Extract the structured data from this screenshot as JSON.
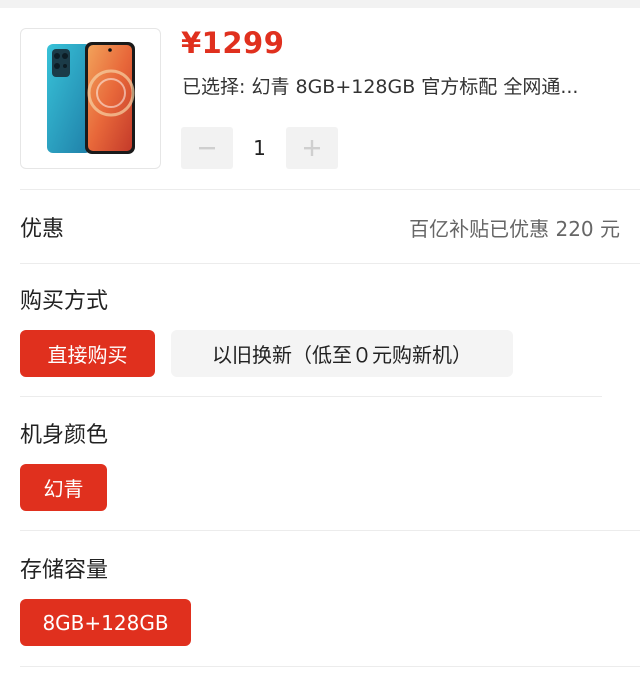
{
  "product": {
    "price": "¥1299",
    "selected_text": "已选择: 幻青 8GB+128GB 官方标配 全网通...",
    "quantity": "1",
    "image_name": "phone-image"
  },
  "promo": {
    "label": "优惠",
    "value": "百亿补贴已优惠 220 元"
  },
  "purchase": {
    "label": "购买方式",
    "options": [
      "直接购买",
      "以旧换新（低至０元购新机）"
    ],
    "selected_index": 0
  },
  "color": {
    "label": "机身颜色",
    "options": [
      "幻青"
    ],
    "selected_index": 0
  },
  "storage": {
    "label": "存储容量",
    "options": [
      "8GB+128GB"
    ],
    "selected_index": 0
  },
  "theme": {
    "accent": "#e0301e",
    "chip_inactive_bg": "#f4f4f4",
    "divider": "#ececec"
  },
  "icons": {
    "minus": "minus-icon",
    "plus": "plus-icon"
  }
}
